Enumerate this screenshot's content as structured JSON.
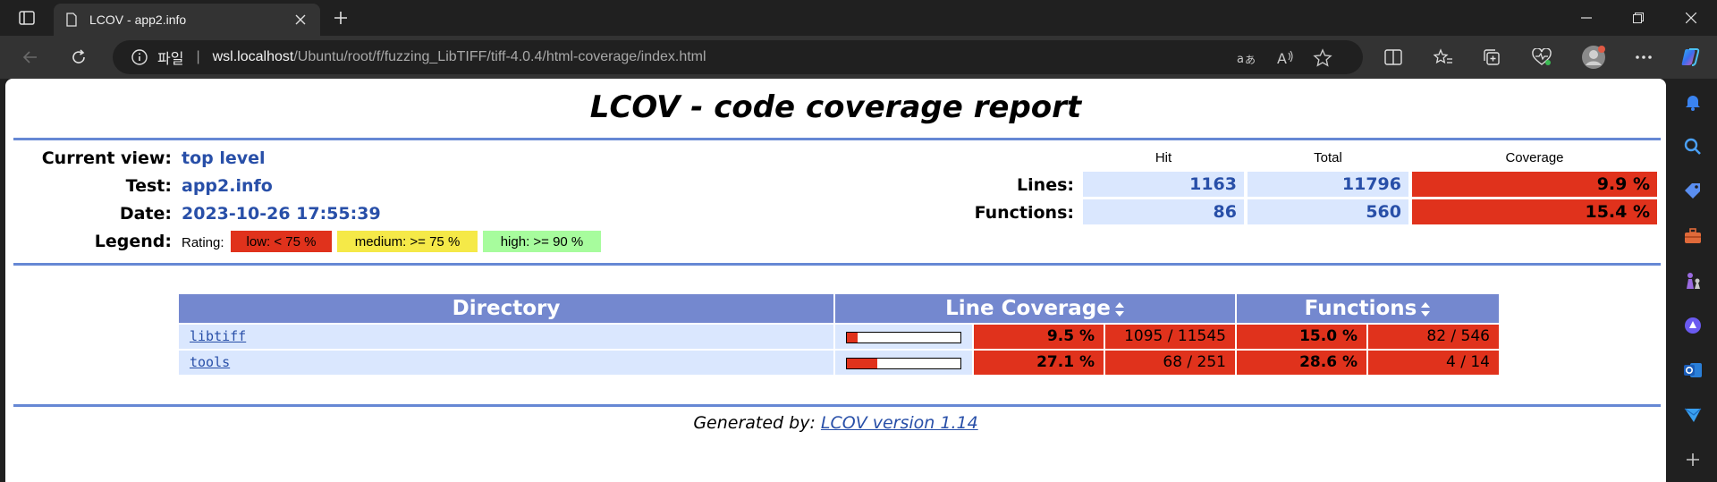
{
  "browser": {
    "tab_title": "LCOV - app2.info",
    "address": {
      "site_label": "파일",
      "separator": "|",
      "host": "wsl.localhost",
      "path": "/Ubuntu/root/f/fuzzing_LibTIFF/tiff-4.0.4/html-coverage/index.html"
    },
    "accent_color": "#1a73e8"
  },
  "report": {
    "title": "LCOV - code coverage report",
    "header": {
      "current_view_label": "Current view:",
      "current_view_value": "top level",
      "test_label": "Test:",
      "test_value": "app2.info",
      "date_label": "Date:",
      "date_value": "2023-10-26 17:55:39",
      "legend_label": "Legend:",
      "legend_rating": "Rating:",
      "legend_low": "low: < 75 %",
      "legend_medium": "medium: >= 75 %",
      "legend_high": "high: >= 90 %"
    },
    "summary": {
      "col_hit": "Hit",
      "col_total": "Total",
      "col_coverage": "Coverage",
      "lines_label": "Lines:",
      "lines_hit": "1163",
      "lines_total": "11796",
      "lines_coverage": "9.9 %",
      "functions_label": "Functions:",
      "functions_hit": "86",
      "functions_total": "560",
      "functions_coverage": "15.4 %"
    },
    "table": {
      "col_directory": "Directory",
      "col_line_coverage": "Line Coverage",
      "col_functions": "Functions",
      "rows": [
        {
          "name": "libtiff",
          "line_pct": "9.5 %",
          "line_ratio": "1095 / 11545",
          "line_fraction": 0.095,
          "func_pct": "15.0 %",
          "func_ratio": "82 / 546"
        },
        {
          "name": "tools",
          "line_pct": "27.1 %",
          "line_ratio": "68 / 251",
          "line_fraction": 0.271,
          "func_pct": "28.6 %",
          "func_ratio": "4 / 14"
        }
      ]
    },
    "footer": {
      "generated_by": "Generated by:",
      "lcov_link": "LCOV version 1.14"
    },
    "colors": {
      "rule": "#6688d4",
      "low": "#e0321c",
      "medium": "#f5e948",
      "high": "#a7fc9d",
      "header_bg": "#7488cf",
      "cell_bg": "#dae7fe",
      "value_text": "#284fa8"
    }
  }
}
